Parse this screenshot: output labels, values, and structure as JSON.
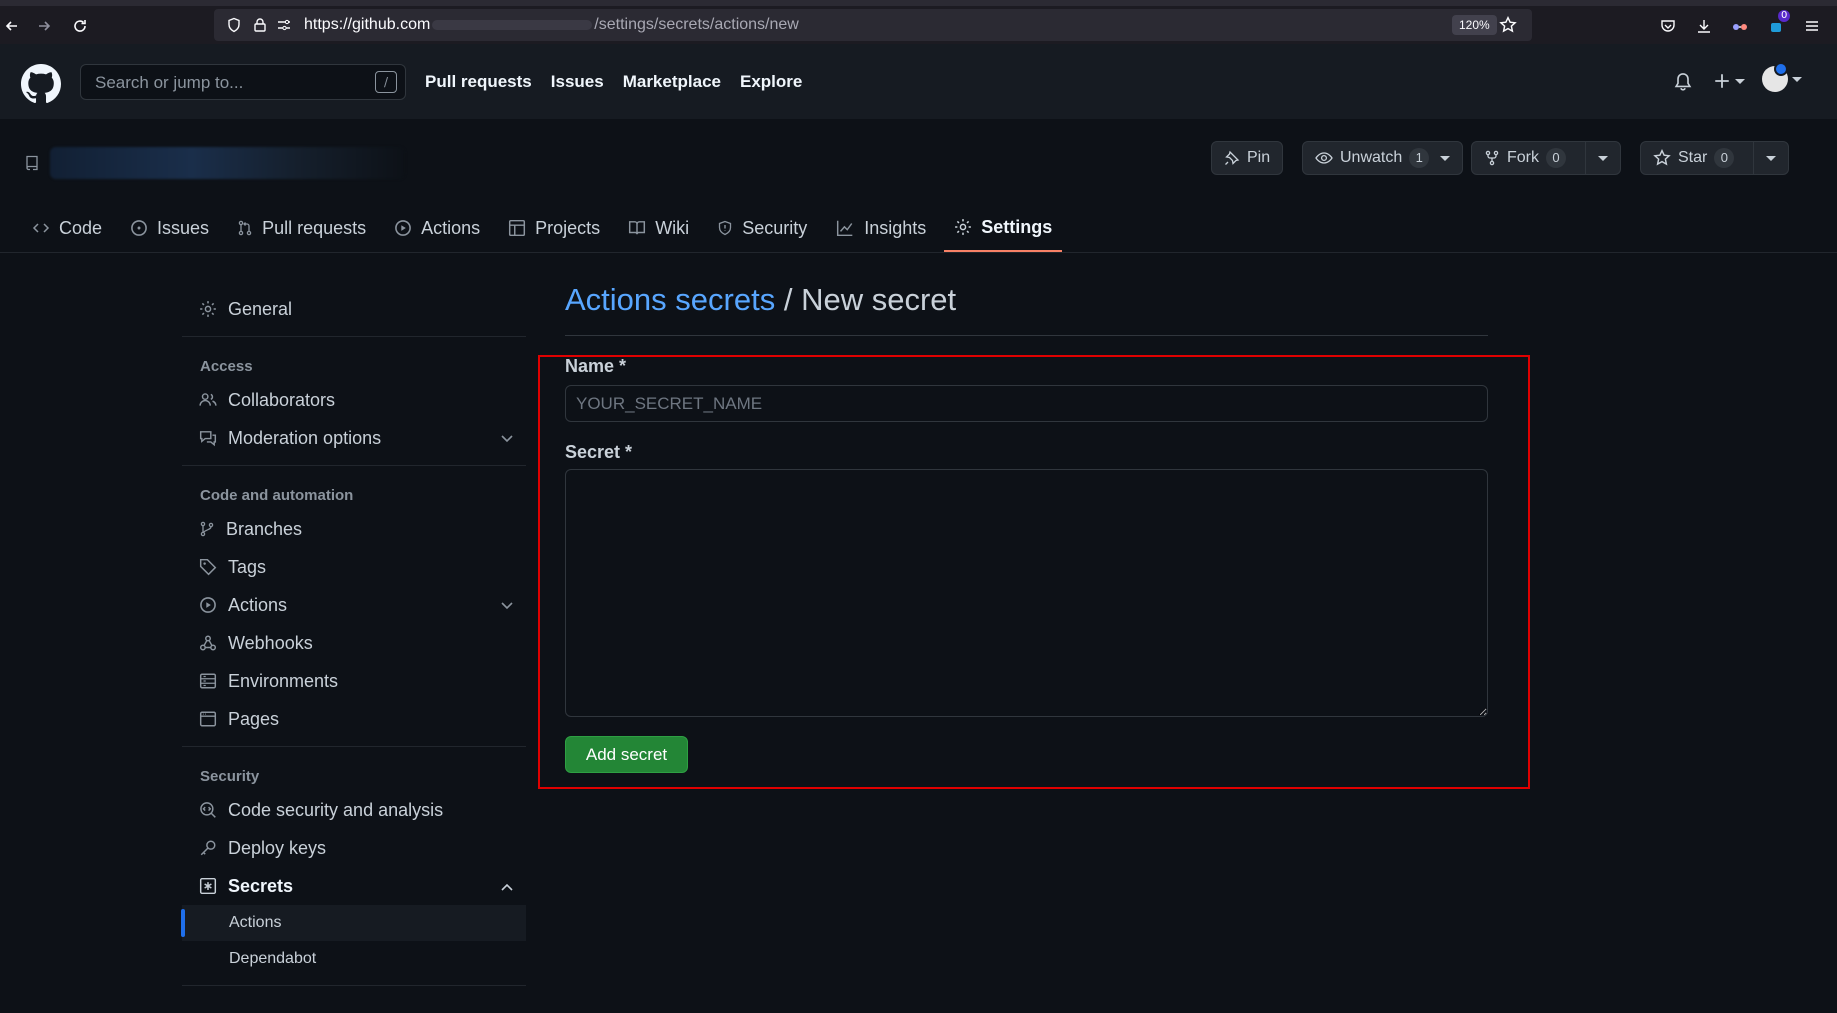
{
  "browser": {
    "url_prefix": "https://github.com",
    "url_suffix": "/settings/secrets/actions/new",
    "zoom": "120%",
    "notification_count": "0"
  },
  "header": {
    "search_placeholder": "Search or jump to...",
    "search_shortcut": "/",
    "nav": [
      "Pull requests",
      "Issues",
      "Marketplace",
      "Explore"
    ]
  },
  "repo": {
    "pin_label": "Pin",
    "unwatch_label": "Unwatch",
    "unwatch_count": "1",
    "fork_label": "Fork",
    "fork_count": "0",
    "star_label": "Star",
    "star_count": "0",
    "tabs": {
      "code": "Code",
      "issues": "Issues",
      "pull_requests": "Pull requests",
      "actions": "Actions",
      "projects": "Projects",
      "wiki": "Wiki",
      "security": "Security",
      "insights": "Insights",
      "settings": "Settings"
    }
  },
  "sidebar": {
    "general": "General",
    "access_heading": "Access",
    "collaborators": "Collaborators",
    "moderation": "Moderation options",
    "code_heading": "Code and automation",
    "branches": "Branches",
    "tags": "Tags",
    "actions": "Actions",
    "webhooks": "Webhooks",
    "environments": "Environments",
    "pages": "Pages",
    "security_heading": "Security",
    "code_security": "Code security and analysis",
    "deploy_keys": "Deploy keys",
    "secrets": "Secrets",
    "secrets_actions": "Actions",
    "secrets_dependabot": "Dependabot"
  },
  "main": {
    "breadcrumb": "Actions secrets",
    "separator": "/",
    "title": "New secret",
    "name_label": "Name *",
    "name_placeholder": "YOUR_SECRET_NAME",
    "name_value": "",
    "secret_label": "Secret *",
    "secret_value": "",
    "submit_label": "Add secret"
  },
  "colors": {
    "background": "#0d1117",
    "link": "#58a6ff",
    "primary_button": "#238636",
    "active_tab_underline": "#f78166",
    "highlight_outline": "#e00000"
  }
}
